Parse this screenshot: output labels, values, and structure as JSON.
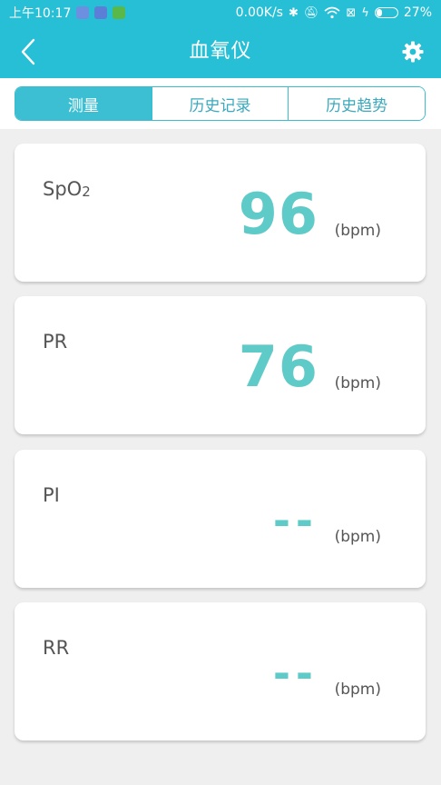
{
  "status_bar": {
    "time": "上午10:17",
    "network_speed": "0.00K/s",
    "battery_percent": "27%",
    "battery_level": 0.27
  },
  "app_bar": {
    "title": "血氧仪",
    "back_icon": "chevron-left-icon",
    "settings_icon": "gear-icon"
  },
  "tabs": [
    {
      "label": "测量",
      "active": true
    },
    {
      "label": "历史记录",
      "active": false
    },
    {
      "label": "历史趋势",
      "active": false
    }
  ],
  "cards": [
    {
      "label": "SpO",
      "label_sub": "2",
      "value": "96",
      "unit": "(bpm)"
    },
    {
      "label": "PR",
      "label_sub": "",
      "value": "76",
      "unit": "(bpm)"
    },
    {
      "label": "PI",
      "label_sub": "",
      "value": "--",
      "unit": "(bpm)"
    },
    {
      "label": "RR",
      "label_sub": "",
      "value": "--",
      "unit": "(bpm)"
    }
  ],
  "colors": {
    "primary": "#26bfd6",
    "value": "#5fcbc8",
    "background": "#efefef"
  }
}
